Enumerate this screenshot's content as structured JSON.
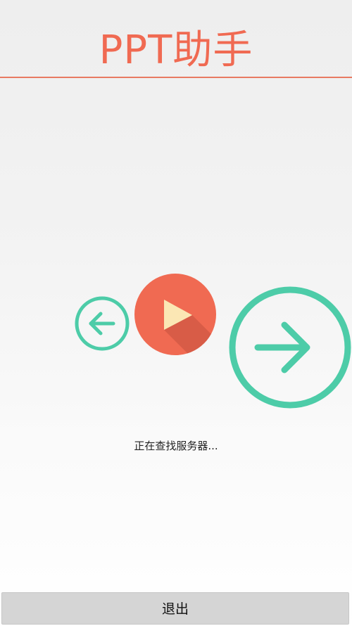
{
  "header": {
    "title": "PPT助手"
  },
  "controls": {
    "prev_icon": "arrow-left-circle-icon",
    "play_icon": "play-icon",
    "next_icon": "arrow-right-circle-icon"
  },
  "status": {
    "text": "正在查找服务器..."
  },
  "footer": {
    "exit_label": "退出"
  },
  "colors": {
    "title": "#f06a52",
    "accent_green": "#4dcca8",
    "play_red": "#f06a52",
    "play_triangle": "#fbe7b4",
    "button_bg": "#d5d5d5"
  }
}
